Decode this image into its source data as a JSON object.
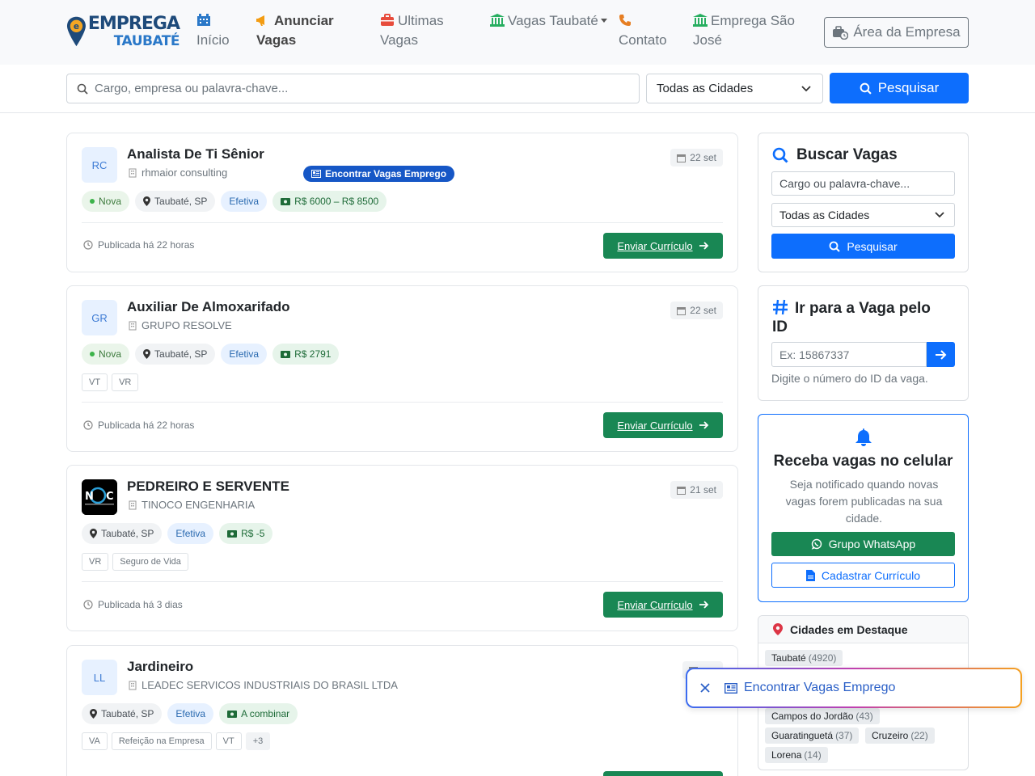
{
  "brand": {
    "line1": "EMPREGA",
    "line2": "TAUBATÉ"
  },
  "nav": {
    "inicio": "Início",
    "anunciar_1": "Anunciar",
    "anunciar_2": "Vagas",
    "ultimas_1": "Ultimas",
    "ultimas_2": "Vagas",
    "taubate": "Vagas Taubaté",
    "contato": "Contato",
    "sjc_1": "Emprega São",
    "sjc_2": "José",
    "area_empresa": "Área da Empresa"
  },
  "search": {
    "placeholder": "Cargo, empresa ou palavra-chave...",
    "city": "Todas as Cidades",
    "button": "Pesquisar"
  },
  "jobs": [
    {
      "title": "Analista De Ti Sênior",
      "company": "rhmaior consulting",
      "avatar": "RC",
      "date": "22 set",
      "new": "Nova",
      "location": "Taubaté, SP",
      "type": "Efetiva",
      "salary": "R$ 6000 – R$ 8500",
      "published": "Publicada há 22 horas",
      "action": "Enviar Currículo",
      "inline_pill": "Encontrar Vagas Emprego"
    },
    {
      "title": "Auxiliar De Almoxarifado",
      "company": "GRUPO RESOLVE",
      "avatar": "GR",
      "date": "22 set",
      "new": "Nova",
      "location": "Taubaté, SP",
      "type": "Efetiva",
      "salary": "R$ 2791",
      "tags": [
        "VT",
        "VR"
      ],
      "published": "Publicada há 22 horas",
      "action": "Enviar Currículo"
    },
    {
      "title": "PEDREIRO E SERVENTE",
      "company": "TINOCO ENGENHARIA",
      "date": "21 set",
      "location": "Taubaté, SP",
      "type": "Efetiva",
      "salary": "R$ -5",
      "tags": [
        "VR",
        "Seguro de Vida"
      ],
      "published": "Publicada há 3 dias",
      "action": "Enviar Currículo"
    },
    {
      "title": "Jardineiro",
      "company": "LEADEC SERVICOS INDUSTRIAIS DO BRASIL LTDA",
      "avatar": "LL",
      "location": "Taubaté, SP",
      "type": "Efetiva",
      "salary": "A combinar",
      "tags": [
        "VA",
        "Refeição na Empresa",
        "VT",
        "+3"
      ]
    }
  ],
  "sidebar": {
    "buscar": {
      "title": "Buscar Vagas",
      "placeholder": "Cargo ou palavra-chave...",
      "city": "Todas as Cidades",
      "button": "Pesquisar"
    },
    "id_search": {
      "title_1": "Ir para a Vaga pelo",
      "title_2": "ID",
      "placeholder": "Ex: 15867337",
      "help": "Digite o número do ID da vaga."
    },
    "notify": {
      "title": "Receba vagas no celular",
      "text": "Seja notificado quando novas vagas forem publicadas na sua cidade.",
      "whatsapp": "Grupo WhatsApp",
      "curriculo": "Cadastrar Currículo"
    },
    "cities": {
      "title": "Cidades em Destaque",
      "items": [
        {
          "name": "Taubaté",
          "count": "(4920)"
        },
        {
          "name": "Campos do Jordão",
          "count": "(43)"
        },
        {
          "name": "Guaratinguetá",
          "count": "(37)"
        },
        {
          "name": "Cruzeiro",
          "count": "(22)"
        },
        {
          "name": "Lorena",
          "count": "(14)"
        }
      ]
    }
  },
  "floating": {
    "label": "Encontrar Vagas Emprego"
  },
  "colors": {
    "primary": "#0d6efd",
    "success": "#198754",
    "brand_dark": "#1e4a7a",
    "brand_light": "#2a78c8"
  }
}
